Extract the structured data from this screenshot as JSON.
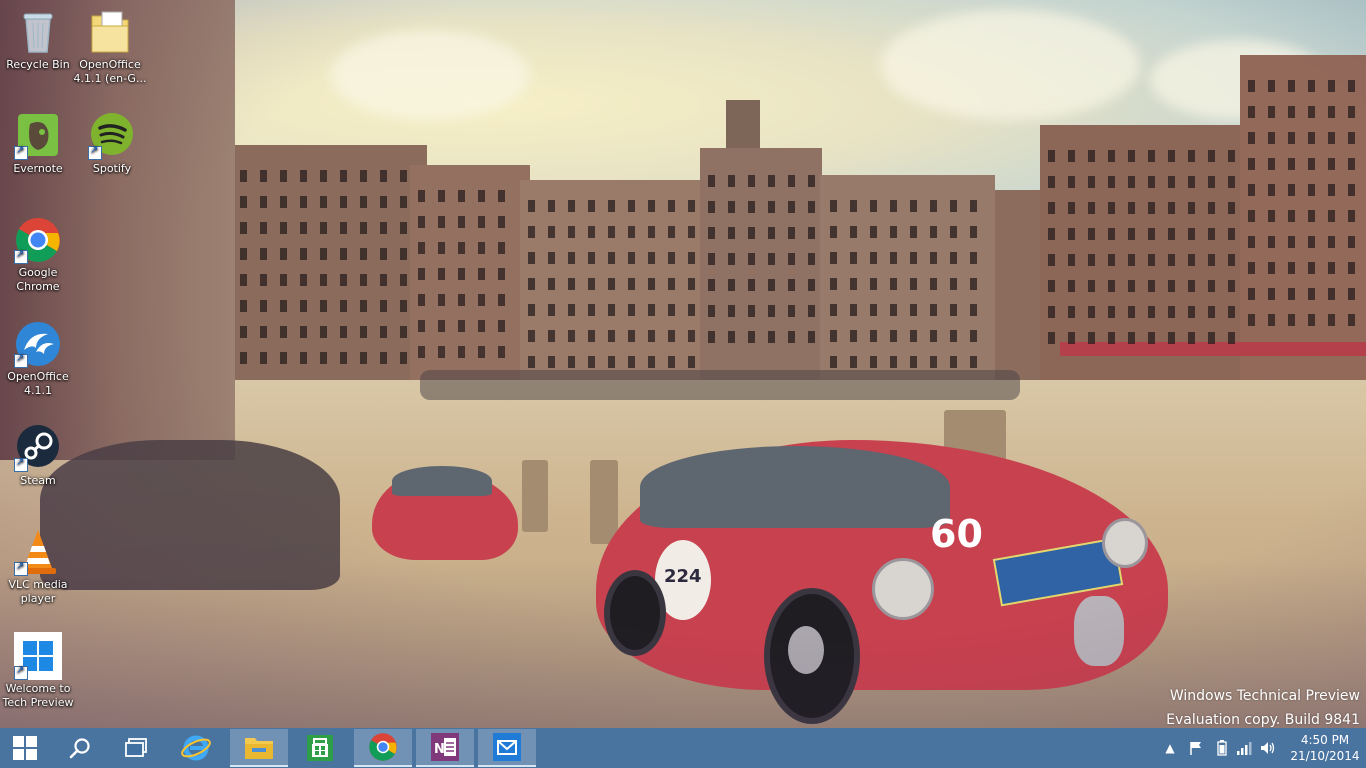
{
  "desktop": {
    "icons": [
      {
        "label": "Recycle Bin",
        "icon": "recycle-bin-icon"
      },
      {
        "label": "OpenOffice\n4.1.1 (en-G...",
        "icon": "openoffice-folder-icon"
      },
      {
        "label": "Evernote",
        "icon": "evernote-icon"
      },
      {
        "label": "Spotify",
        "icon": "spotify-icon"
      },
      {
        "label": "Google\nChrome",
        "icon": "chrome-icon"
      },
      {
        "label": "OpenOffice\n4.1.1",
        "icon": "openoffice-icon"
      },
      {
        "label": "Steam",
        "icon": "steam-icon"
      },
      {
        "label": "VLC media\nplayer",
        "icon": "vlc-icon"
      },
      {
        "label": "Welcome to\nTech Preview",
        "icon": "windows-logo-icon"
      }
    ],
    "wallpaper_plates": {
      "front": "60",
      "side": "224"
    }
  },
  "watermark": {
    "line1": "Windows Technical Preview",
    "line2": "Evaluation copy. Build 9841"
  },
  "taskbar": {
    "start_icon": "windows-start-icon",
    "search_icon": "search-icon",
    "task_view_icon": "task-view-icon",
    "apps": [
      {
        "name": "Internet Explorer",
        "icon": "internet-explorer-icon",
        "active": false
      },
      {
        "name": "File Explorer",
        "icon": "file-explorer-icon",
        "active": true
      },
      {
        "name": "Store",
        "icon": "store-icon",
        "active": false
      },
      {
        "name": "Google Chrome",
        "icon": "chrome-icon",
        "active": true
      },
      {
        "name": "OneNote",
        "icon": "onenote-icon",
        "active": true
      },
      {
        "name": "Mail",
        "icon": "mail-icon",
        "active": true
      }
    ],
    "tray": {
      "icons": [
        "chevron-up-icon",
        "action-center-flag-icon",
        "battery-icon",
        "network-signal-icon",
        "volume-icon"
      ],
      "time": "4:50 PM",
      "date": "21/10/2014"
    }
  },
  "colors": {
    "taskbar": "#4070a2",
    "car_red": "#c8414f"
  }
}
